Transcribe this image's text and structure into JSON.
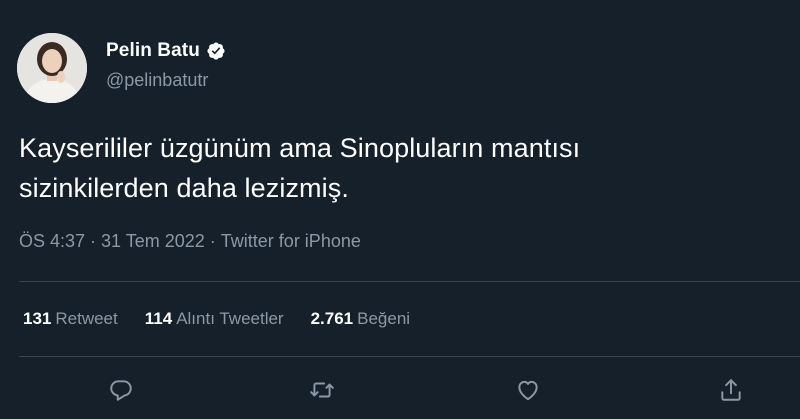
{
  "author": {
    "display_name": "Pelin Batu",
    "handle": "@pelinbatutr",
    "verified": true,
    "avatar_icon": "profile-photo"
  },
  "tweet": {
    "text_line1": "Kayserililer üzgünüm ama Sinopluların mantısı",
    "text_line2": "sizinkilerden daha lezizmiş."
  },
  "meta": {
    "time": "ÖS 4:37",
    "separator": "·",
    "date": "31 Tem 2022",
    "source": "Twitter for iPhone"
  },
  "stats": {
    "retweets_count": "131",
    "retweets_label": "Retweet",
    "quotes_count": "114",
    "quotes_label": "Alıntı Tweetler",
    "likes_count": "2.761",
    "likes_label": "Beğeni"
  },
  "actions": {
    "icons": [
      "reply-icon",
      "retweet-icon",
      "like-icon",
      "share-icon"
    ]
  },
  "colors": {
    "background": "#15202b",
    "text_primary": "#ffffff",
    "text_secondary": "#8b98a5",
    "divider": "#38444d",
    "verified_badge": "#ffffff"
  }
}
